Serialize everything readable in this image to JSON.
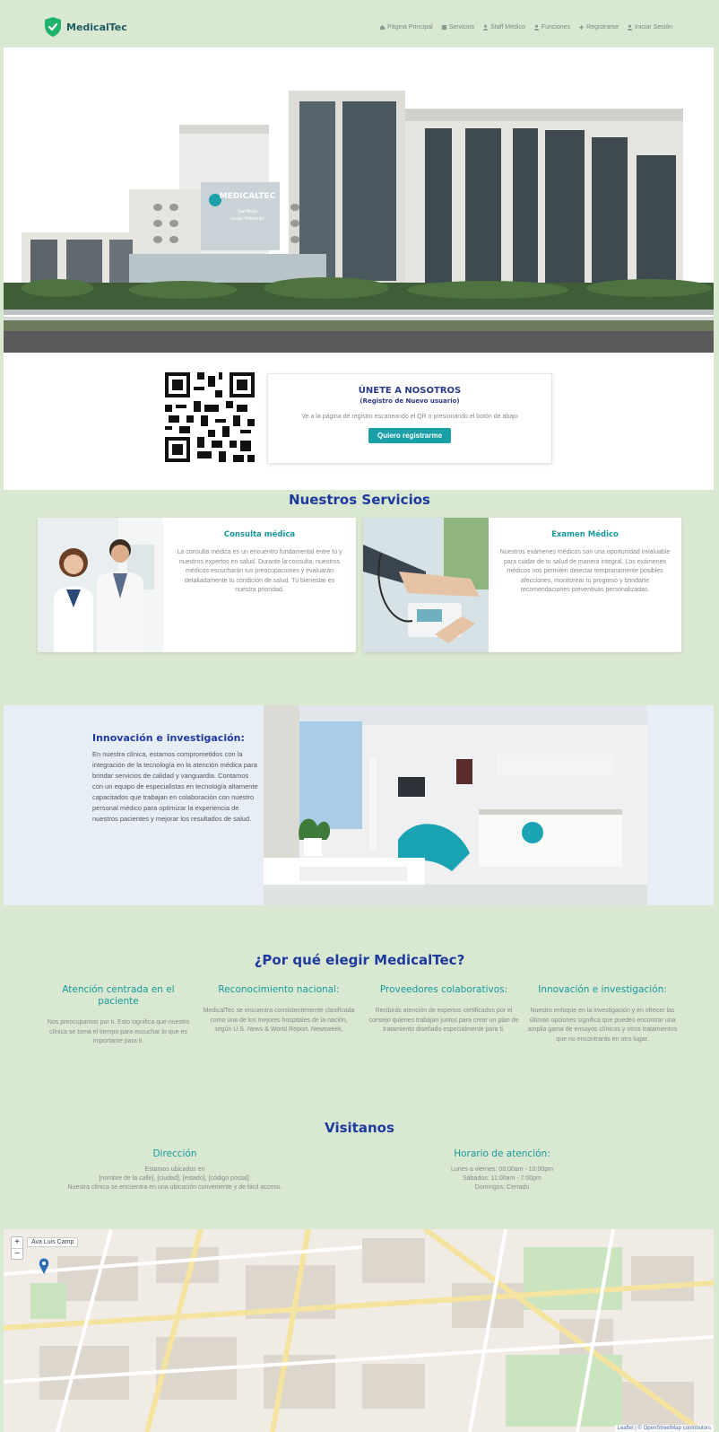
{
  "header": {
    "brand": "MedicalTec",
    "nav": [
      {
        "icon": "home-icon",
        "label": "Página Principal"
      },
      {
        "icon": "grid-icon",
        "label": "Servicios"
      },
      {
        "icon": "user-icon",
        "label": "Staff Médico"
      },
      {
        "icon": "user-icon",
        "label": "Funciones"
      },
      {
        "icon": "plus-icon",
        "label": "Registrarse"
      },
      {
        "icon": "user-icon",
        "label": "Iniciar Sesión"
      }
    ]
  },
  "hero": {
    "building_sign": "MEDICALTEC",
    "building_sign_sub": "San Borja",
    "building_sign_sub2": "Grupo Telemedic"
  },
  "join": {
    "title": "ÚNETE A NOSOTROS",
    "subtitle": "(Registro de Nuevo usuario)",
    "description": "Ve a la página de registro escaneando el QR o presionando el botón de abajo",
    "button": "Quiero registrarme"
  },
  "services": {
    "title": "Nuestros Servicios",
    "cards": [
      {
        "title": "Consulta médica",
        "text": "La consulta médica es un encuentro fundamental entre tú y nuestros expertos en salud. Durante la consulta, nuestros médicos escucharán tus preocupaciones y evaluarán detalladamente tu condición de salud. Tu bienestar es nuestra prioridad."
      },
      {
        "title": "Examen Médico",
        "text": "Nuestros exámenes médicos son una oportunidad invaluable para cuidar de tu salud de manera integral. Los exámenes médicos nos permiten detectar tempranamente posibles afecciones, monitorear tu progreso y brindarte recomendaciones preventivas personalizadas."
      }
    ]
  },
  "innovation": {
    "title": "Innovación e investigación:",
    "text": "En nuestra clínica, estamos comprometidos con la integración de la tecnología en la atención médica para brindar servicios de calidad y vanguardia. Contamos con un equipo de especialistas en tecnología altamente capacitados que trabajan en colaboración con nuestro personal médico para optimizar la experiencia de nuestros pacientes y mejorar los resultados de salud."
  },
  "why": {
    "title": "¿Por qué elegir MedicalTec?",
    "items": [
      {
        "title": "Atención centrada en el paciente",
        "text": "Nos preocupamos por ti. Esto significa que nuestro clínica se toma el tiempo para escuchar lo que es importante para ti."
      },
      {
        "title": "Reconocimiento nacional:",
        "text": "MedicalTec se encuentra consistentemente clasificada como una de los mejores hospitales de la nación, según U.S. News & World Report. Newsweek."
      },
      {
        "title": "Proveedores colaborativos:",
        "text": "Recibirás atención de expertos certificados por el consejo quienes trabajan juntos para crear un plan de tratamiento diseñado especialmente para ti."
      },
      {
        "title": "Innovación e investigación:",
        "text": "Nuestro enfoque en la investigación y en ofrecer las últimas opciones significa que puedes encontrar una amplia gama de ensayos clínicos y otros tratamientos que no encontrarás en otro lugar."
      }
    ]
  },
  "visit": {
    "title": "Visitanos",
    "address_title": "Dirección",
    "address_lines": [
      "Estamos ubicados en",
      "[nombre de la calle], [ciudad], [estado], [código postal].",
      "Nuestra clínica se encuentra en una ubicación conveniente y de fácil acceso."
    ],
    "hours_title": "Horario de atención:",
    "hours_lines": [
      "Lunes a viernes: 08:00am - 10:00pm",
      "Sábados: 11:00am - 7:00pm",
      "Domingos: Cerrado"
    ]
  },
  "map": {
    "zoom_in": "+",
    "zoom_out": "−",
    "marker_label": "Ava Luis Camp",
    "attribution": "Leaflet | © OpenStreetMap contributors"
  },
  "colors": {
    "page_bg": "#d9e8d1",
    "brand_teal": "#17989c",
    "heading_blue": "#1e3a9e"
  }
}
